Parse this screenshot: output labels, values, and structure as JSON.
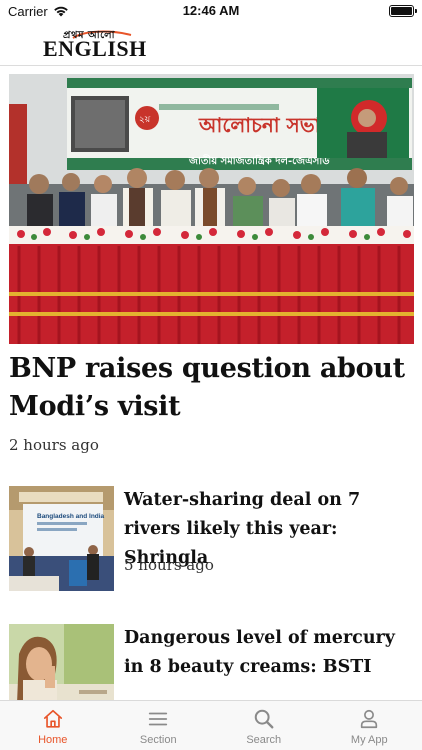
{
  "status_bar": {
    "carrier": "Carrier",
    "time": "12:46 AM"
  },
  "header": {
    "logo_text_bn": "প্রথম আলো",
    "logo_text_en": "ENGLISH"
  },
  "hero": {
    "title": "BNP raises question about Modi’s visit",
    "time": "2 hours ago",
    "banner_text_main": "আলোচনা সভা",
    "banner_text_party": "জাতীয় সমাজতান্ত্রিক দল-জেএসডি"
  },
  "stories": [
    {
      "title": "Water-sharing deal on 7 rivers likely this year: Shringla",
      "time": "5 hours ago",
      "thumb_text": "Bangladesh and India"
    },
    {
      "title": "Dangerous level of mercury in 8 beauty creams: BSTI",
      "time": ""
    }
  ],
  "tabs": [
    {
      "label": "Home",
      "icon": "home-icon",
      "active": true
    },
    {
      "label": "Section",
      "icon": "menu-icon",
      "active": false
    },
    {
      "label": "Search",
      "icon": "search-icon",
      "active": false
    },
    {
      "label": "My App",
      "icon": "user-icon",
      "active": false
    }
  ],
  "colors": {
    "accent": "#e8552a",
    "inactive": "#8a8a8a"
  }
}
